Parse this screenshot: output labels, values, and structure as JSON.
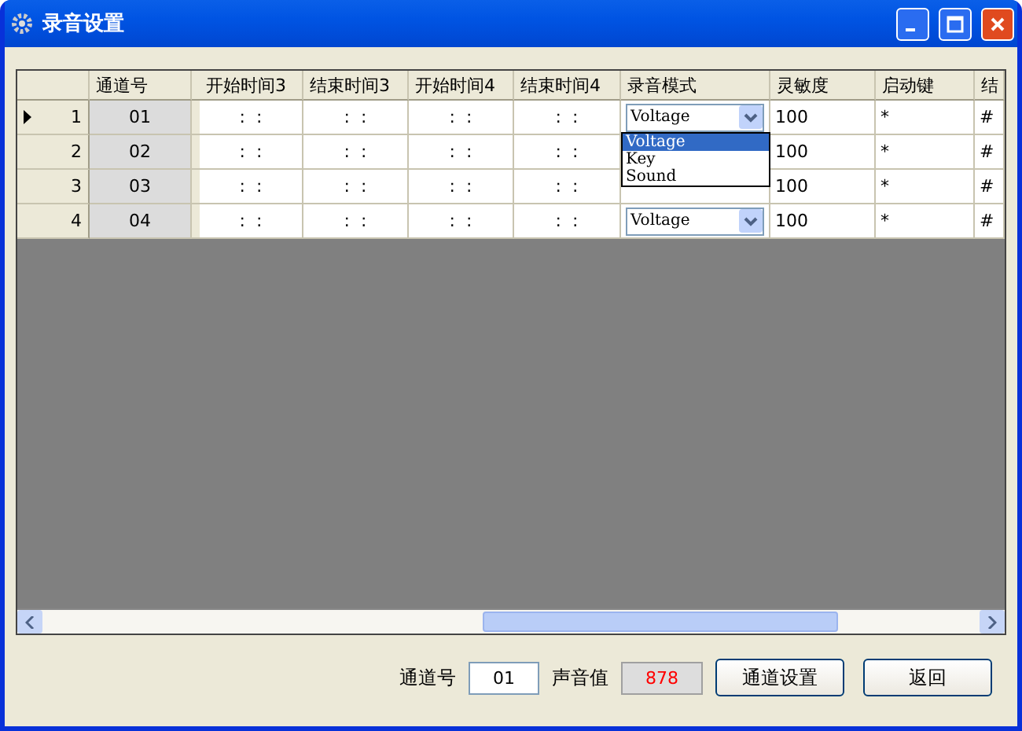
{
  "window": {
    "title": "录音设置"
  },
  "table": {
    "columns": [
      "通道号",
      "开始时间3",
      "结束时间3",
      "开始时间4",
      "结束时间4",
      "录音模式",
      "灵敏度",
      "启动键",
      "结"
    ],
    "rows": [
      {
        "number": "1",
        "selected": true,
        "channel": "01",
        "times": [
          ":  :",
          ":  :",
          ":  :",
          ":  :"
        ],
        "mode": "Voltage",
        "sensitivity": "100",
        "start_key": "*",
        "end_key": "#"
      },
      {
        "number": "2",
        "selected": false,
        "channel": "02",
        "times": [
          ":  :",
          ":  :",
          ":  :",
          ":  :"
        ],
        "sensitivity": "100",
        "start_key": "*",
        "end_key": "#"
      },
      {
        "number": "3",
        "selected": false,
        "channel": "03",
        "times": [
          ":  :",
          ":  :",
          ":  :",
          ":  :"
        ],
        "sensitivity": "100",
        "start_key": "*",
        "end_key": "#"
      },
      {
        "number": "4",
        "selected": false,
        "channel": "04",
        "times": [
          ":  :",
          ":  :",
          ":  :",
          ":  :"
        ],
        "mode": "Voltage",
        "sensitivity": "100",
        "start_key": "*",
        "end_key": "#"
      }
    ],
    "dropdown": {
      "options": [
        {
          "label": "Voltage",
          "selected": true
        },
        {
          "label": "Key",
          "selected": false
        },
        {
          "label": "Sound",
          "selected": false
        }
      ]
    }
  },
  "footer": {
    "channel_label": "通道号",
    "channel_value": "01",
    "sound_label": "声音值",
    "sound_value": "878",
    "buttons": [
      "通道设置",
      "返回"
    ]
  }
}
